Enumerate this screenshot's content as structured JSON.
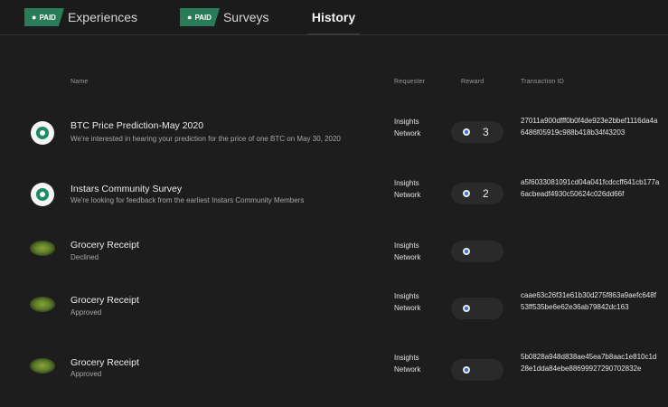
{
  "tabs": [
    {
      "badge": "PAID",
      "label": "Experiences"
    },
    {
      "badge": "PAID",
      "label": "Surveys"
    },
    {
      "label": "History"
    }
  ],
  "headers": {
    "name": "Name",
    "requester": "Requester",
    "reward": "Reward",
    "transaction": "Transaction ID"
  },
  "rows": [
    {
      "icon": "insights-logo-icon",
      "title": "BTC Price Prediction-May 2020",
      "subtitle": "We're interested in hearing your prediction for the price of one BTC on May 30, 2020",
      "requester_line1": "Insights",
      "requester_line2": "Network",
      "reward": "3",
      "txid": "27011a900dfff0b0f4de923e2bbef1116da4a6486f05919c988b418b34f43203"
    },
    {
      "icon": "insights-logo-icon",
      "title": "Instars Community Survey",
      "subtitle": "We're looking for feedback from the earliest Instars Community Members",
      "requester_line1": "Insights",
      "requester_line2": "Network",
      "reward": "2",
      "txid": "a5f6033081091cd04a041fcdccff641cb177a6acbeadf4930c50624c026dd66f"
    },
    {
      "icon": "receipt-image",
      "title": "Grocery Receipt",
      "subtitle": "Declined",
      "requester_line1": "Insights",
      "requester_line2": "Network",
      "reward": "",
      "txid": ""
    },
    {
      "icon": "receipt-image",
      "title": "Grocery Receipt",
      "subtitle": "Approved",
      "requester_line1": "Insights",
      "requester_line2": "Network",
      "reward": "",
      "txid": "caae63c26f31e61b30d275f863a9aefc648f53ff535be6e62e36ab79842dc163"
    },
    {
      "icon": "receipt-image",
      "title": "Grocery Receipt",
      "subtitle": "Approved",
      "requester_line1": "Insights",
      "requester_line2": "Network",
      "reward": "",
      "txid": "5b0828a948d838ae45ea7b8aac1e810c1d28e1dda84ebe88699927290702832e"
    }
  ]
}
